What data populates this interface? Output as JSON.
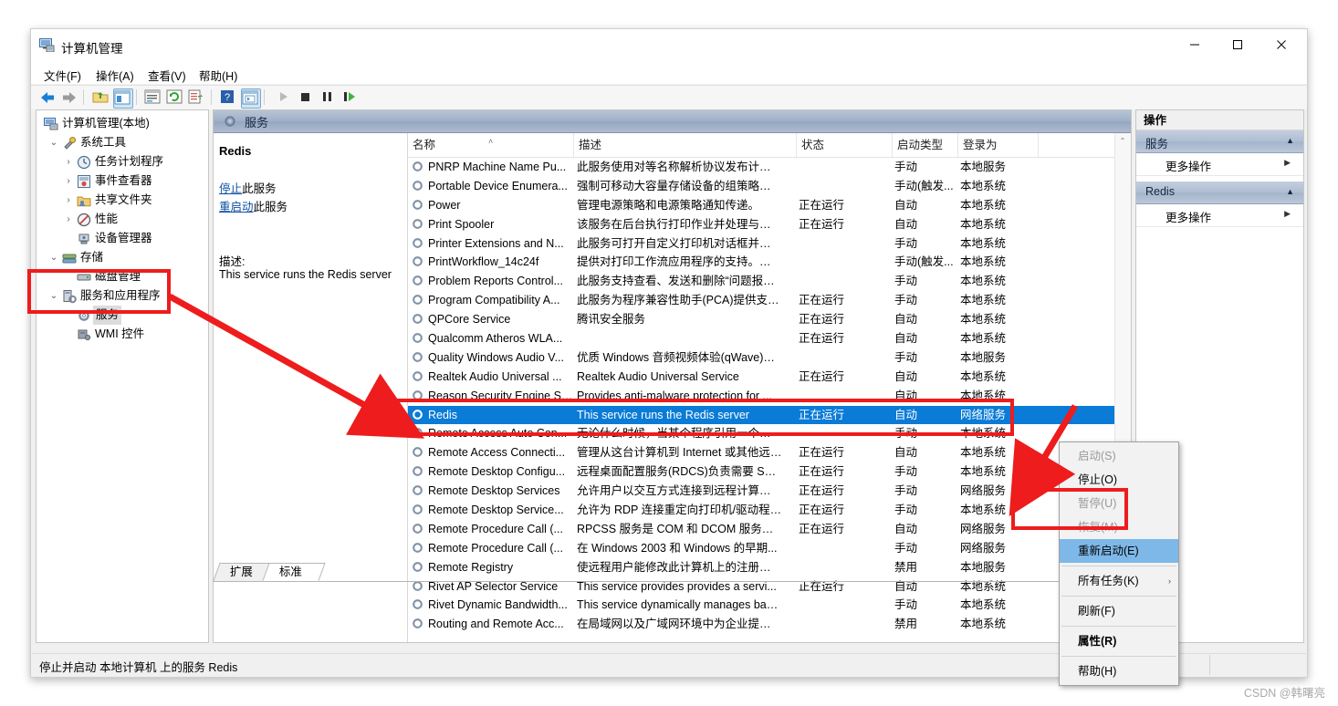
{
  "window": {
    "title": "计算机管理",
    "icon": "computer-management-icon",
    "minimize": "—",
    "maximize": "□",
    "close": "✕"
  },
  "menubar": [
    "文件(F)",
    "操作(A)",
    "查看(V)",
    "帮助(H)"
  ],
  "toolbar": {
    "buttons": [
      "back-arrow",
      "forward-arrow",
      "up-folder",
      "show-hide-tree",
      "properties",
      "refresh",
      "export-list",
      "help",
      "show-hide-action-pane",
      "start-service",
      "stop-service",
      "pause-service",
      "restart-service"
    ]
  },
  "tree": {
    "root": "计算机管理(本地)",
    "items": [
      {
        "label": "系统工具",
        "depth": 1,
        "chevron": "expanded",
        "icon": "tools-icon"
      },
      {
        "label": "任务计划程序",
        "depth": 2,
        "chevron": "collapsed",
        "icon": "clock-icon"
      },
      {
        "label": "事件查看器",
        "depth": 2,
        "chevron": "collapsed",
        "icon": "event-viewer-icon"
      },
      {
        "label": "共享文件夹",
        "depth": 2,
        "chevron": "collapsed",
        "icon": "shared-folder-icon"
      },
      {
        "label": "性能",
        "depth": 2,
        "chevron": "collapsed",
        "icon": "performance-icon"
      },
      {
        "label": "设备管理器",
        "depth": 2,
        "chevron": "none",
        "icon": "device-manager-icon"
      },
      {
        "label": "存储",
        "depth": 1,
        "chevron": "expanded",
        "icon": "storage-icon"
      },
      {
        "label": "磁盘管理",
        "depth": 2,
        "chevron": "none",
        "icon": "disk-icon"
      },
      {
        "label": "服务和应用程序",
        "depth": 1,
        "chevron": "expanded",
        "icon": "services-apps-icon"
      },
      {
        "label": "服务",
        "depth": 2,
        "chevron": "none",
        "icon": "gear-icon",
        "selected": true
      },
      {
        "label": "WMI 控件",
        "depth": 2,
        "chevron": "none",
        "icon": "wmi-icon"
      }
    ]
  },
  "console": {
    "header_title": "服务",
    "header_icon": "gear-icon"
  },
  "detail": {
    "service_name": "Redis",
    "link_stop_prefix": "停止",
    "link_stop_suffix": "此服务",
    "link_restart_prefix": "重启动",
    "link_restart_suffix": "此服务",
    "description_label": "描述:",
    "description": "This service runs the Redis server"
  },
  "list": {
    "columns": [
      "名称",
      "描述",
      "状态",
      "启动类型",
      "登录为"
    ],
    "sort_caret": "˄",
    "rows": [
      {
        "name": "PNRP Machine Name Pu...",
        "desc": "此服务使用对等名称解析协议发布计算机...",
        "state": "",
        "start": "手动",
        "logon": "本地服务"
      },
      {
        "name": "Portable Device Enumera...",
        "desc": "强制可移动大容量存储设备的组策略。使...",
        "state": "",
        "start": "手动(触发...",
        "logon": "本地系统"
      },
      {
        "name": "Power",
        "desc": "管理电源策略和电源策略通知传递。",
        "state": "正在运行",
        "start": "自动",
        "logon": "本地系统"
      },
      {
        "name": "Print Spooler",
        "desc": "该服务在后台执行打印作业并处理与打印...",
        "state": "正在运行",
        "start": "自动",
        "logon": "本地系统"
      },
      {
        "name": "Printer Extensions and N...",
        "desc": "此服务可打开自定义打印机对话框并处理...",
        "state": "",
        "start": "手动",
        "logon": "本地系统"
      },
      {
        "name": "PrintWorkflow_14c24f",
        "desc": "提供对打印工作流应用程序的支持。如果...",
        "state": "",
        "start": "手动(触发...",
        "logon": "本地系统"
      },
      {
        "name": "Problem Reports Control...",
        "desc": "此服务支持查看、发送和删除“问题报告”...",
        "state": "",
        "start": "手动",
        "logon": "本地系统"
      },
      {
        "name": "Program Compatibility A...",
        "desc": "此服务为程序兼容性助手(PCA)提供支持...",
        "state": "正在运行",
        "start": "手动",
        "logon": "本地系统"
      },
      {
        "name": "QPCore Service",
        "desc": "腾讯安全服务",
        "state": "正在运行",
        "start": "自动",
        "logon": "本地系统"
      },
      {
        "name": "Qualcomm Atheros WLA...",
        "desc": "",
        "state": "正在运行",
        "start": "自动",
        "logon": "本地系统"
      },
      {
        "name": "Quality Windows Audio V...",
        "desc": "优质 Windows 音频视频体验(qWave)是...",
        "state": "",
        "start": "手动",
        "logon": "本地服务"
      },
      {
        "name": "Realtek Audio Universal ...",
        "desc": "Realtek Audio Universal Service",
        "state": "正在运行",
        "start": "自动",
        "logon": "本地系统"
      },
      {
        "name": "Reason Security Engine Sm...",
        "desc": "Provides anti-malware protection for ...",
        "state": "",
        "start": "自动",
        "logon": "本地系统"
      },
      {
        "name": "Redis",
        "desc": "This service runs the Redis server",
        "state": "正在运行",
        "start": "自动",
        "logon": "网络服务",
        "selected": true
      },
      {
        "name": "Remote Access Auto Con...",
        "desc": "无论什么时候，当某个程序引用一个远程 ...",
        "state": "",
        "start": "手动",
        "logon": "本地系统"
      },
      {
        "name": "Remote Access Connecti...",
        "desc": "管理从这台计算机到 Internet 或其他远程...",
        "state": "正在运行",
        "start": "自动",
        "logon": "本地系统"
      },
      {
        "name": "Remote Desktop Configu...",
        "desc": "远程桌面配置服务(RDCS)负责需要 SYST...",
        "state": "正在运行",
        "start": "手动",
        "logon": "本地系统"
      },
      {
        "name": "Remote Desktop Services",
        "desc": "允许用户以交互方式连接到远程计算机。...",
        "state": "正在运行",
        "start": "手动",
        "logon": "网络服务"
      },
      {
        "name": "Remote Desktop Service...",
        "desc": "允许为 RDP 连接重定向打印机/驱动程序...",
        "state": "正在运行",
        "start": "手动",
        "logon": "本地系统"
      },
      {
        "name": "Remote Procedure Call (...",
        "desc": "RPCSS 服务是 COM 和 DCOM 服务器...",
        "state": "正在运行",
        "start": "自动",
        "logon": "网络服务"
      },
      {
        "name": "Remote Procedure Call (...",
        "desc": "在 Windows 2003 和 Windows 的早期...",
        "state": "",
        "start": "手动",
        "logon": "网络服务"
      },
      {
        "name": "Remote Registry",
        "desc": "使远程用户能修改此计算机上的注册表设...",
        "state": "",
        "start": "禁用",
        "logon": "本地服务"
      },
      {
        "name": "Rivet AP Selector Service",
        "desc": "This service provides provides a servi...",
        "state": "正在运行",
        "start": "自动",
        "logon": "本地系统"
      },
      {
        "name": "Rivet Dynamic Bandwidth...",
        "desc": "This service dynamically manages ban...",
        "state": "",
        "start": "手动",
        "logon": "本地系统"
      },
      {
        "name": "Routing and Remote Acc...",
        "desc": "在局域网以及广域网环境中为企业提供路...",
        "state": "",
        "start": "禁用",
        "logon": "本地系统"
      }
    ]
  },
  "actions": {
    "header": "操作",
    "groups": [
      {
        "title": "服务",
        "collapse_icon": "chevron-up-icon",
        "items": [
          {
            "label": "更多操作",
            "arrow": "▶"
          }
        ]
      },
      {
        "title": "Redis",
        "collapse_icon": "chevron-up-icon",
        "items": [
          {
            "label": "更多操作",
            "arrow": "▶"
          }
        ]
      }
    ]
  },
  "tabs": [
    {
      "label": "扩展",
      "active": false
    },
    {
      "label": "标准",
      "active": true
    }
  ],
  "statusbar": {
    "text": "停止并启动 本地计算机 上的服务 Redis"
  },
  "context_menu": {
    "items": [
      {
        "label": "启动(S)",
        "disabled": true
      },
      {
        "label": "停止(O)",
        "disabled": false
      },
      {
        "label": "暂停(U)",
        "disabled": true
      },
      {
        "label": "恢复(M)",
        "disabled": true
      },
      {
        "label": "重新启动(E)",
        "disabled": false,
        "highlighted": true
      },
      {
        "separator": true
      },
      {
        "label": "所有任务(K)",
        "disabled": false,
        "submenu": "›"
      },
      {
        "separator": true
      },
      {
        "label": "刷新(F)",
        "disabled": false
      },
      {
        "separator": true
      },
      {
        "label": "属性(R)",
        "disabled": false,
        "bold": true
      },
      {
        "separator": true
      },
      {
        "label": "帮助(H)",
        "disabled": false
      }
    ]
  },
  "annotations": {
    "color": "#ee1c1c",
    "boxes": [
      "tree-services-node",
      "redis-row",
      "context-menu-restart"
    ],
    "arrows": [
      "tree-to-redis-row",
      "contextmenu-pointer"
    ]
  },
  "watermark": "CSDN @韩曙亮"
}
